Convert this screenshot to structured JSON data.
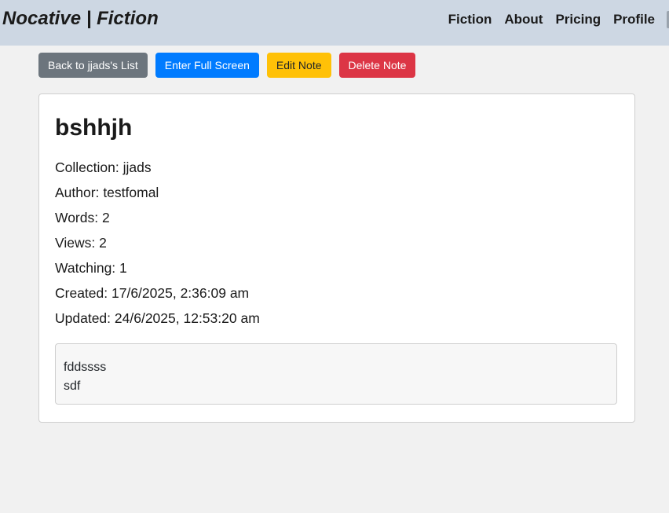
{
  "navbar": {
    "brand": "Nocative | Fiction",
    "links": [
      "Fiction",
      "About",
      "Pricing",
      "Profile"
    ]
  },
  "toolbar": {
    "back_label": "Back to jjads's List",
    "fullscreen_label": "Enter Full Screen",
    "edit_label": "Edit Note",
    "delete_label": "Delete Note"
  },
  "note": {
    "title": "bshhjh",
    "meta": [
      {
        "label": "Collection:",
        "value": "jjads"
      },
      {
        "label": "Author:",
        "value": "testfomal"
      },
      {
        "label": "Words:",
        "value": "2"
      },
      {
        "label": "Views:",
        "value": "2"
      },
      {
        "label": "Watching:",
        "value": "1"
      },
      {
        "label": "Created:",
        "value": "17/6/2025, 2:36:09 am"
      },
      {
        "label": "Updated:",
        "value": "24/6/2025, 12:53:20 am"
      }
    ],
    "content_lines": [
      "fddssss",
      "sdf"
    ]
  },
  "colors": {
    "navbar_bg": "#cdd7e3",
    "page_bg": "#f1f1f1",
    "btn_secondary": "#6c757d",
    "btn_primary": "#007bff",
    "btn_warning": "#ffc107",
    "btn_danger": "#dc3545"
  }
}
